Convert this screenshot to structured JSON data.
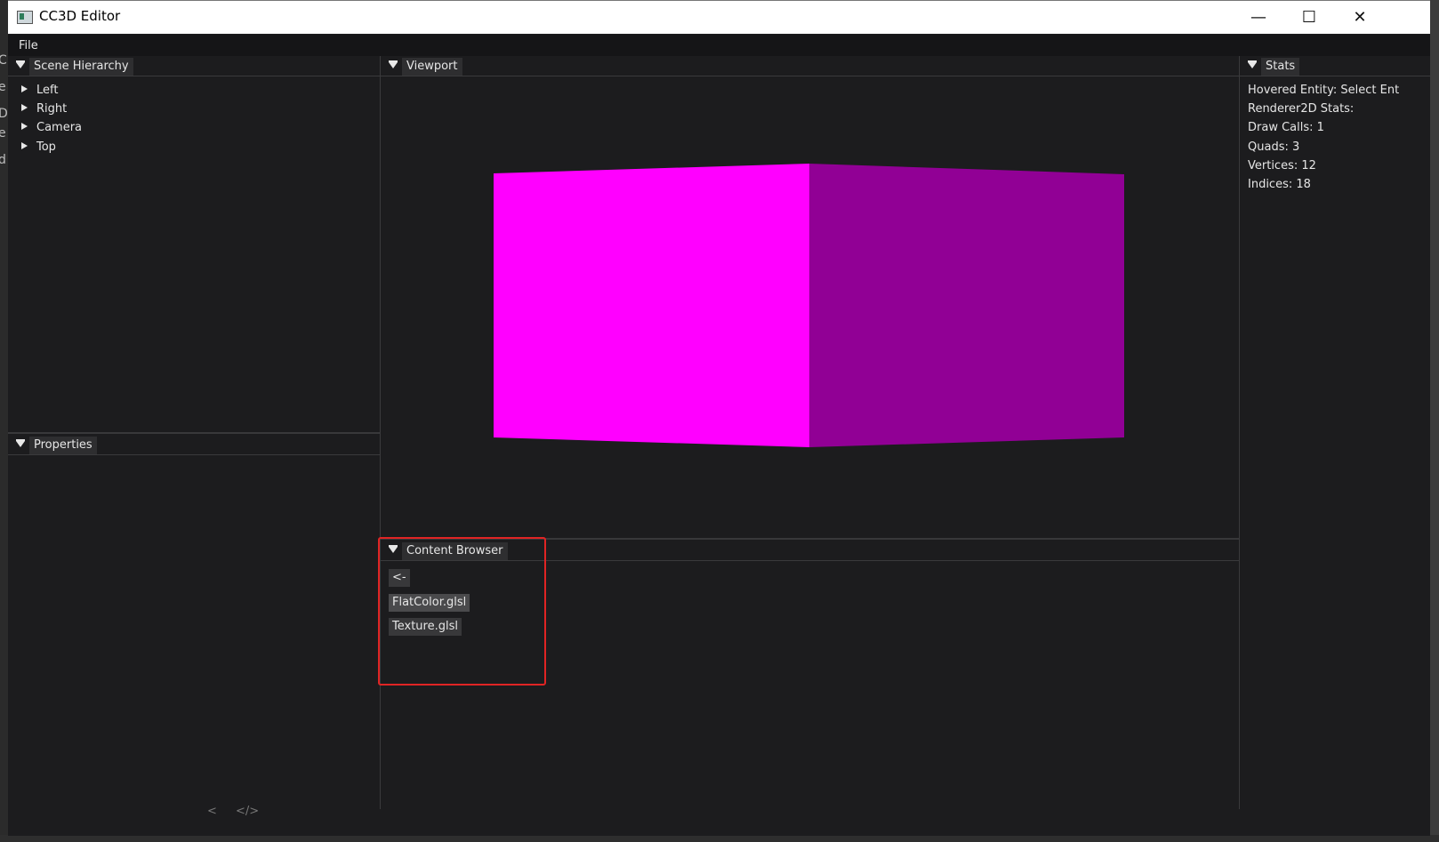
{
  "window": {
    "title": "CC3D Editor",
    "controls": {
      "minimize": "—",
      "maximize": "☐",
      "close": "✕"
    }
  },
  "menubar": {
    "file": "File"
  },
  "panels": {
    "scene_hierarchy": {
      "tab": "Scene Hierarchy",
      "items": [
        "Left",
        "Right",
        "Camera",
        "Top"
      ]
    },
    "properties": {
      "tab": "Properties"
    },
    "viewport": {
      "tab": "Viewport"
    },
    "stats": {
      "tab": "Stats",
      "lines": [
        "Hovered Entity: Select Ent",
        "Renderer2D Stats:",
        "Draw Calls: 1",
        "Quads: 3",
        "Vertices: 12",
        "Indices: 18"
      ]
    },
    "content_browser": {
      "tab": "Content Browser",
      "back": "<-",
      "files": [
        "FlatColor.glsl",
        "Texture.glsl"
      ]
    }
  },
  "scene": {
    "front_color": "#ff00ff",
    "side_color": "#910095"
  },
  "background_window": {
    "side_glyphs": [
      "C",
      "e",
      "D",
      "e",
      "d"
    ],
    "footer_glyphs": [
      "<",
      "</>"
    ]
  }
}
